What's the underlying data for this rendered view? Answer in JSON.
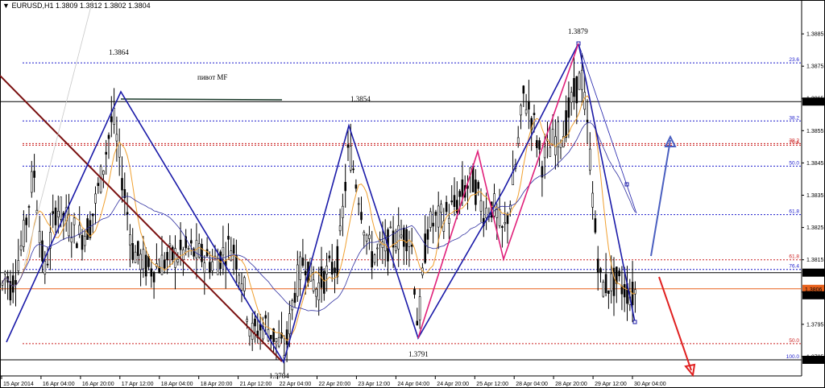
{
  "header": {
    "symbol": "EURUSD,H1",
    "ohlc": "1.3809 1.3812 1.3802 1.3804"
  },
  "chart_data": {
    "type": "candlestick",
    "ylim": [
      1.3779,
      1.3892
    ],
    "y_ticks": [
      "1.3885",
      "1.3875",
      "1.3865",
      "1.3855",
      "1.3845",
      "1.3835",
      "1.3825",
      "1.3815",
      "1.3805",
      "1.3795",
      "1.3785"
    ],
    "x_ticks": [
      "15 Apr 2014",
      "16 Apr 04:00",
      "16 Apr 20:00",
      "17 Apr 12:00",
      "18 Apr 04:00",
      "18 Apr 20:00",
      "21 Apr 12:00",
      "22 Apr 04:00",
      "22 Apr 20:00",
      "23 Apr 12:00",
      "24 Apr 04:00",
      "24 Apr 20:00",
      "25 Apr 12:00",
      "28 Apr 04:00",
      "28 Apr 20:00",
      "29 Apr 12:00",
      "30 Apr 04:00"
    ],
    "price_boxes": [
      {
        "value": "1.3864",
        "bg": "#000000",
        "fg": "#ffffff"
      },
      {
        "value": "1.3811",
        "bg": "#000000",
        "fg": "#ffffff"
      },
      {
        "value": "1.3806",
        "bg": "#e8611c",
        "fg": "#ffffff"
      },
      {
        "value": "1.3804",
        "bg": "#000000",
        "fg": "#ffffff"
      },
      {
        "value": "1.3784",
        "bg": "#000000",
        "fg": "#ffffff"
      }
    ],
    "fib_levels": [
      {
        "label": "23.6",
        "price": 1.3876,
        "color": "#1a1acc"
      },
      {
        "label": "38.2",
        "price": 1.3858,
        "color": "#1a1acc"
      },
      {
        "label": "38.2",
        "price": 1.3851,
        "color": "#cc2020"
      },
      {
        "label": "76.4",
        "price": 1.38505,
        "color": "#cc2020"
      },
      {
        "label": "50.0",
        "price": 1.3844,
        "color": "#1a1acc"
      },
      {
        "label": "61.8",
        "price": 1.3829,
        "color": "#1a1acc"
      },
      {
        "label": "61.8",
        "price": 1.3815,
        "color": "#cc2020"
      },
      {
        "label": "76.4",
        "price": 1.3812,
        "color": "#1a1acc"
      },
      {
        "label": "50.0",
        "price": 1.3789,
        "color": "#cc2020"
      },
      {
        "label": "100.0",
        "price": 1.3784,
        "color": "#1a1acc"
      }
    ],
    "annotations": [
      "1.3864",
      "пивот MF",
      "1.3854",
      "1.3879",
      "1.3791",
      "1.3784"
    ]
  },
  "colors": {
    "candle": "#000000",
    "ma_fast": "#f0a030",
    "ma_slow": "#3030a0",
    "zigzag_blue": "#1a1aa8",
    "zigzag_pink": "#e0207a",
    "trendline": "#7a1010",
    "arrow_up": "#4a5fc0",
    "arrow_down": "#e02020",
    "horizontal_orange": "#e8611c"
  }
}
